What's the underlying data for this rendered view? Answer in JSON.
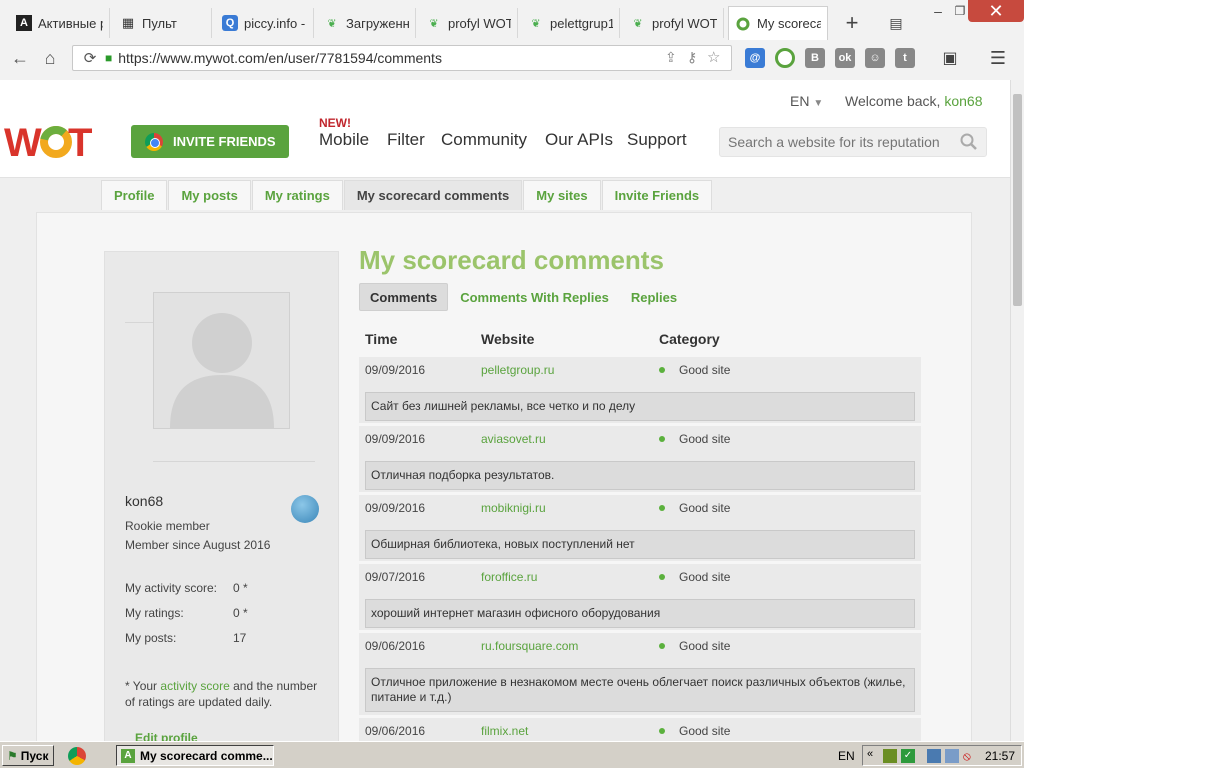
{
  "browser": {
    "tabs": [
      {
        "title": "Активные р",
        "icon": "a-letter-icon"
      },
      {
        "title": "Пульт",
        "icon": "grid-icon"
      },
      {
        "title": "piccy.info -",
        "icon": "magnifier-icon"
      },
      {
        "title": "Загруженна",
        "icon": "leaf-icon"
      },
      {
        "title": "profyl WOT",
        "icon": "leaf-icon"
      },
      {
        "title": "pelettgrup1",
        "icon": "leaf-icon"
      },
      {
        "title": "profyl WOT",
        "icon": "leaf-icon"
      },
      {
        "title": "My scorecar",
        "icon": "wot-icon"
      }
    ],
    "url": "https://www.mywot.com/en/user/7781594/comments"
  },
  "header": {
    "invite_label": "INVITE FRIENDS",
    "new_badge": "NEW!",
    "nav": [
      "Mobile",
      "Filter",
      "Community",
      "Our APIs",
      "Support"
    ],
    "lang": "EN",
    "welcome_prefix": "Welcome back,",
    "welcome_user": "kon68",
    "search_placeholder": "Search a website for its reputation"
  },
  "profile_tabs": [
    "Profile",
    "My posts",
    "My ratings",
    "My scorecard comments",
    "My sites",
    "Invite Friends"
  ],
  "sidebar": {
    "username": "kon68",
    "rank": "Rookie member",
    "member_since": "Member since August 2016",
    "stats": [
      {
        "label": "My activity score:",
        "value": "0 *"
      },
      {
        "label": "My ratings:",
        "value": "0 *"
      },
      {
        "label": "My posts:",
        "value": "17"
      }
    ],
    "note_prefix": "* Your",
    "note_link": "activity score",
    "note_suffix": "and the number of ratings are updated daily.",
    "edit_profile": "Edit profile"
  },
  "main": {
    "title": "My scorecard comments",
    "subtabs": [
      "Comments",
      "Comments With Replies",
      "Replies"
    ],
    "columns": [
      "Time",
      "Website",
      "Category"
    ],
    "rows": [
      {
        "time": "09/09/2016",
        "site": "pelletgroup.ru",
        "category": "Good site",
        "comment": "Сайт без лишней рекламы, все четко и по делу"
      },
      {
        "time": "09/09/2016",
        "site": "aviasovet.ru",
        "category": "Good site",
        "comment": "Отличная подборка результатов."
      },
      {
        "time": "09/09/2016",
        "site": "mobiknigi.ru",
        "category": "Good site",
        "comment": "Обширная библиотека, новых поступлений нет"
      },
      {
        "time": "09/07/2016",
        "site": "foroffice.ru",
        "category": "Good site",
        "comment": "хороший интернет магазин офисного оборудования"
      },
      {
        "time": "09/06/2016",
        "site": "ru.foursquare.com",
        "category": "Good site",
        "comment": "Отличное приложение в незнакомом месте очень облегчает поиск различных объектов (жилье, питание и т.д.)"
      },
      {
        "time": "09/06/2016",
        "site": "filmix.net",
        "category": "Good site",
        "comment": ""
      }
    ]
  },
  "taskbar": {
    "start": "Пуск",
    "active_window": "My scorecard comme...",
    "lang": "EN",
    "clock": "21:57"
  },
  "colors": {
    "accent": "#5aa33e",
    "title_green": "#9bc46b",
    "close_red": "#c74a3e"
  }
}
